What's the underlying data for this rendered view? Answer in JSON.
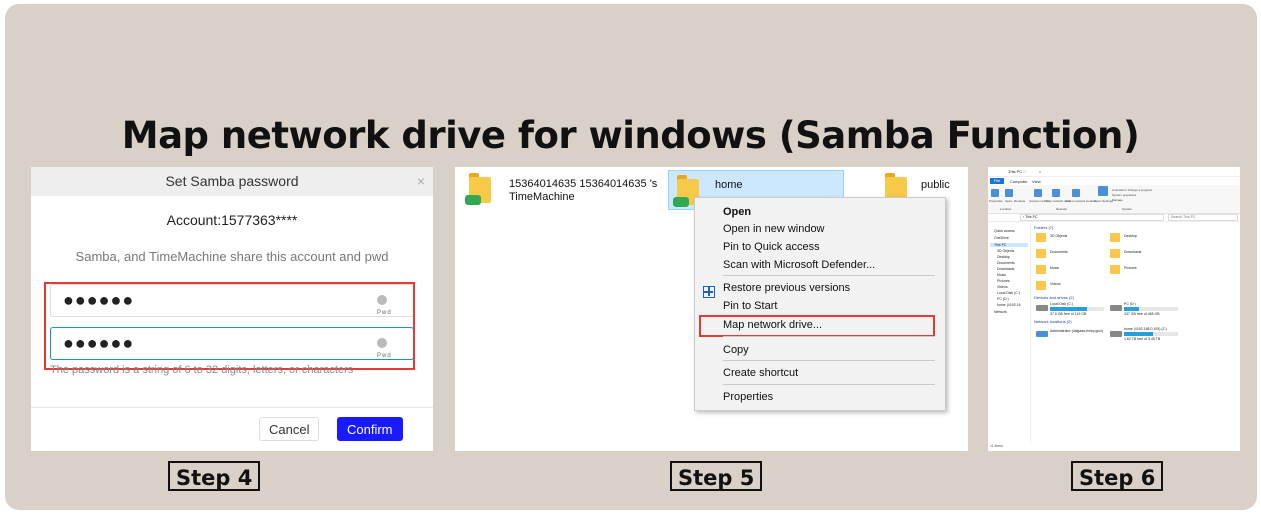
{
  "headline": "Map network drive for windows (Samba Function)",
  "steps": [
    "Step 4",
    "Step 5",
    "Step 6"
  ],
  "samba_dialog": {
    "title": "Set Samba password",
    "close_glyph": "×",
    "account": "Account:1577363****",
    "share_note": "Samba, and TimeMachine share this account and pwd",
    "password_1": "●●●●●●",
    "password_2": "●●●●●●",
    "eye_label": "Pwd",
    "hint": "The password is a string of 6 to 32 digits, letters, or characters",
    "cancel_label": "Cancel",
    "confirm_label": "Confirm"
  },
  "explorer": {
    "folders": [
      {
        "line1": "15364014635 15364014635 's",
        "line2": "TimeMachine"
      },
      {
        "line1": "home",
        "line2": ""
      },
      {
        "line1": "public",
        "line2": ""
      }
    ],
    "context_menu": [
      "Open",
      "Open in new window",
      "Pin to Quick access",
      "Scan with Microsoft Defender...",
      "Restore previous versions",
      "Pin to Start",
      "Map network drive...",
      "Copy",
      "Create shortcut",
      "Properties"
    ]
  },
  "this_pc": {
    "title": "This PC",
    "window_controls": "– □ ×",
    "ribbon_tabs": {
      "file": "File",
      "computer": "Computer",
      "view": "View"
    },
    "ribbon_buttons": [
      "Properties",
      "Open",
      "Rename",
      "Access media",
      "Map network drive",
      "Add a network location",
      "Open Settings",
      "Uninstall or change a program",
      "System properties",
      "Manage"
    ],
    "ribbon_groups": [
      "Location",
      "Network",
      "System"
    ],
    "address": "› This PC",
    "search_placeholder": "Search This PC",
    "nav_items": [
      "Quick access",
      "OneDrive",
      "This PC",
      "3D Objects",
      "Desktop",
      "Documents",
      "Downloads",
      "Music",
      "Pictures",
      "Videos",
      "Local Disk (C:)",
      "PC (D:)",
      "home (\\\\192.16",
      "Network"
    ],
    "folders_header": "Folders (7)",
    "folders": [
      "3D Objects",
      "Desktop",
      "Documents",
      "Downloads",
      "Music",
      "Pictures",
      "Videos"
    ],
    "drives_header": "Devices and drives (2)",
    "drives": [
      {
        "name": "Local Disk (C:)",
        "free": "37.5 GB free of 119 GB",
        "used_fraction": 0.68
      },
      {
        "name": "PC (D:)",
        "free": "337 GB free of 465 GB",
        "used_fraction": 0.28
      }
    ],
    "netloc_header": "Network locations (2)",
    "netlocs": [
      {
        "name": "Administrator (dalgaas-emby.guci)",
        "free": ""
      },
      {
        "name": "home (\\\\192.168.0.193) (Z:)",
        "free": "1.62 TB free of 3.45 TB",
        "used_fraction": 0.53
      }
    ],
    "status": "11 items"
  }
}
